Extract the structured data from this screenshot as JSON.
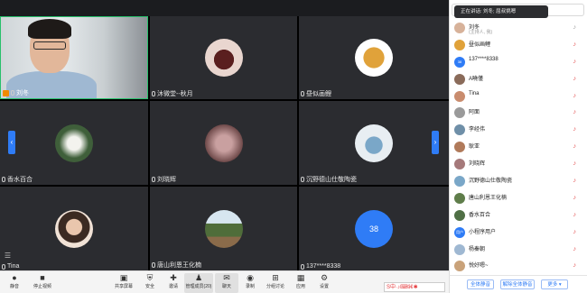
{
  "speaking_banner": "正在讲话: 刘冬; 屈叔挑嗯",
  "tiles": [
    {
      "name": "刘冬",
      "host": true,
      "active": true
    },
    {
      "name": "沐微堂--秋月"
    },
    {
      "name": "昼似画鲤"
    },
    {
      "name": "香水百合"
    },
    {
      "name": "刘晓辉"
    },
    {
      "name": "沉野德山仕敬陶瓷"
    },
    {
      "name": "Tina"
    },
    {
      "name": "唐山利恩王化楠"
    },
    {
      "name": "137****8338",
      "avatar_text": "38"
    }
  ],
  "toolbar": {
    "items": [
      "静音",
      "停止视频",
      "共享屏幕",
      "安全",
      "邀请",
      "管理成员(20)",
      "聊天",
      "录制",
      "分组讨论",
      "应用",
      "设置"
    ]
  },
  "participants": [
    {
      "name": "刘冬",
      "role": "(主持人, 我)",
      "mic": "on"
    },
    {
      "name": "昼似画鲤",
      "mic": "off"
    },
    {
      "name": "137****8338",
      "avatar_text": "38",
      "mic": "off"
    },
    {
      "name": "A曉僅",
      "mic": "off"
    },
    {
      "name": "Tina",
      "mic": "off"
    },
    {
      "name": "阿面",
      "mic": "off"
    },
    {
      "name": "李经伟",
      "mic": "off"
    },
    {
      "name": "耿亚",
      "mic": "off"
    },
    {
      "name": "刘晓辉",
      "mic": "off"
    },
    {
      "name": "沉野德山仕敬陶瓷",
      "mic": "off"
    },
    {
      "name": "唐山利恩王化楠",
      "mic": "off"
    },
    {
      "name": "香水百合",
      "mic": "off"
    },
    {
      "name": "小程序用户",
      "avatar_text": "用户",
      "mic": "off"
    },
    {
      "name": "杨秦朝",
      "mic": "off"
    },
    {
      "name": "悦好嗯~",
      "mic": "off"
    }
  ],
  "panel_buttons": {
    "mute_all": "全体静音",
    "unmute_all": "解除全体静音",
    "more": "更多 ▾"
  },
  "ime_text": "S中·♪⌨⌘✱"
}
